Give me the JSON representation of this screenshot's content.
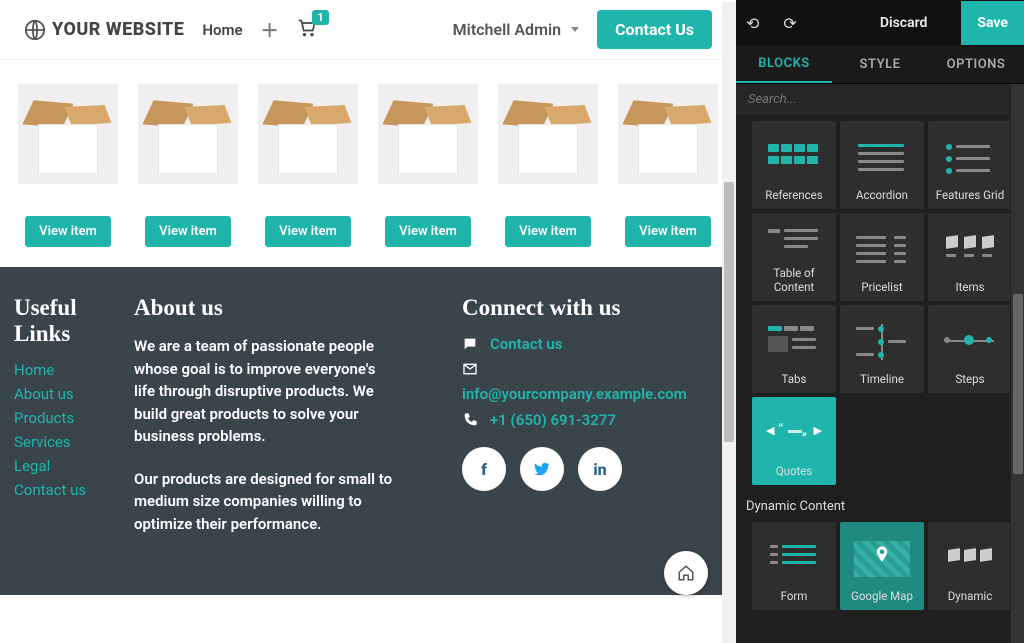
{
  "header": {
    "logo_text": "YOUR WEBSITE",
    "nav_home": "Home",
    "cart_count": "1",
    "user_name": "Mitchell Admin",
    "contact_btn": "Contact Us"
  },
  "products": {
    "view_label": "View item"
  },
  "footer": {
    "links_title": "Useful Links",
    "links": [
      "Home",
      "About us",
      "Products",
      "Services",
      "Legal",
      "Contact us"
    ],
    "about_title": "About us",
    "about_p1": "We are a team of passionate people whose goal is to improve everyone's life through disruptive products. We build great products to solve your business problems.",
    "about_p2": "Our products are designed for small to medium size companies willing to optimize their performance.",
    "connect_title": "Connect with us",
    "contact_link": "Contact us",
    "email": "info@yourcompany.example.com",
    "phone": "+1 (650) 691-3277"
  },
  "editor": {
    "discard": "Discard",
    "save": "Save",
    "tabs": {
      "blocks": "BLOCKS",
      "style": "STYLE",
      "options": "OPTIONS"
    },
    "search_placeholder": "Search...",
    "blocks_row1": [
      "References",
      "Accordion",
      "Features Grid"
    ],
    "blocks_row2": [
      "Table of Content",
      "Pricelist",
      "Items"
    ],
    "blocks_row3": [
      "Tabs",
      "Timeline",
      "Steps"
    ],
    "blocks_row4": [
      "Quotes"
    ],
    "section2_title": "Dynamic Content",
    "blocks_row5": [
      "Form",
      "Google Map",
      "Dynamic"
    ]
  }
}
